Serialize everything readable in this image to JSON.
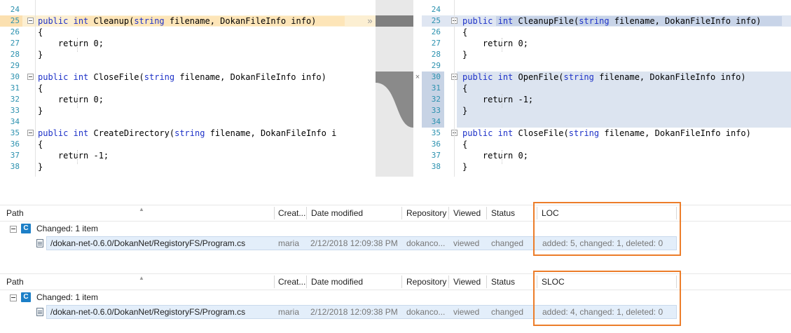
{
  "diff": {
    "left": {
      "lines": [
        {
          "num": "24",
          "code": ""
        },
        {
          "num": "25",
          "code": "public int Cleanup(string filename, DokanFileInfo info)"
        },
        {
          "num": "26",
          "code": "{"
        },
        {
          "num": "27",
          "code": "    return 0;"
        },
        {
          "num": "28",
          "code": "}"
        },
        {
          "num": "29",
          "code": ""
        },
        {
          "num": "30",
          "code": "public int CloseFile(string filename, DokanFileInfo info)"
        },
        {
          "num": "31",
          "code": "{"
        },
        {
          "num": "32",
          "code": "    return 0;"
        },
        {
          "num": "33",
          "code": "}"
        },
        {
          "num": "34",
          "code": ""
        },
        {
          "num": "35",
          "code": "public int CreateDirectory(string filename, DokanFileInfo i"
        },
        {
          "num": "36",
          "code": "{"
        },
        {
          "num": "37",
          "code": "    return -1;"
        },
        {
          "num": "38",
          "code": "}"
        }
      ]
    },
    "right": {
      "lines": [
        {
          "num": "24",
          "code": ""
        },
        {
          "num": "25",
          "code": "public int CleanupFile(string filename, DokanFileInfo info)"
        },
        {
          "num": "26",
          "code": "{"
        },
        {
          "num": "27",
          "code": "    return 0;"
        },
        {
          "num": "28",
          "code": "}"
        },
        {
          "num": "29",
          "code": ""
        },
        {
          "num": "30",
          "code": "public int OpenFile(string filename, DokanFileInfo info)"
        },
        {
          "num": "31",
          "code": "{"
        },
        {
          "num": "32",
          "code": "    return -1;"
        },
        {
          "num": "33",
          "code": "}"
        },
        {
          "num": "34",
          "code": ""
        },
        {
          "num": "35",
          "code": "public int CloseFile(string filename, DokanFileInfo info)"
        },
        {
          "num": "36",
          "code": "{"
        },
        {
          "num": "37",
          "code": "    return 0;"
        },
        {
          "num": "38",
          "code": "}"
        }
      ]
    },
    "connector_marks": {
      "copy": "»",
      "remove": "×"
    }
  },
  "grids": [
    {
      "columns": {
        "path": "Path",
        "created": "Creat...",
        "date": "Date modified",
        "repo": "Repository",
        "viewed": "Viewed",
        "status": "Status",
        "metric": "LOC"
      },
      "group": {
        "badge": "C",
        "label": "Changed: 1 item"
      },
      "row": {
        "path": "/dokan-net-0.6.0/DokanNet/RegistoryFS/Program.cs",
        "created": "maria",
        "date": "2/12/2018 12:09:38 PM",
        "repo": "dokanco...",
        "viewed": "viewed",
        "status": "changed",
        "metric": "added: 5, changed: 1, deleted: 0"
      }
    },
    {
      "columns": {
        "path": "Path",
        "created": "Creat...",
        "date": "Date modified",
        "repo": "Repository",
        "viewed": "Viewed",
        "status": "Status",
        "metric": "SLOC"
      },
      "group": {
        "badge": "C",
        "label": "Changed: 1 item"
      },
      "row": {
        "path": "/dokan-net-0.6.0/DokanNet/RegistoryFS/Program.cs",
        "created": "maria",
        "date": "2/12/2018 12:09:38 PM",
        "repo": "dokanco...",
        "viewed": "viewed",
        "status": "changed",
        "metric": "added: 4, changed: 1, deleted: 0"
      }
    }
  ],
  "colors": {
    "highlight_box": "#ec7d2a",
    "line_number": "#2b91af",
    "keyword": "#1e32c8",
    "badge": "#1c7fc7"
  }
}
